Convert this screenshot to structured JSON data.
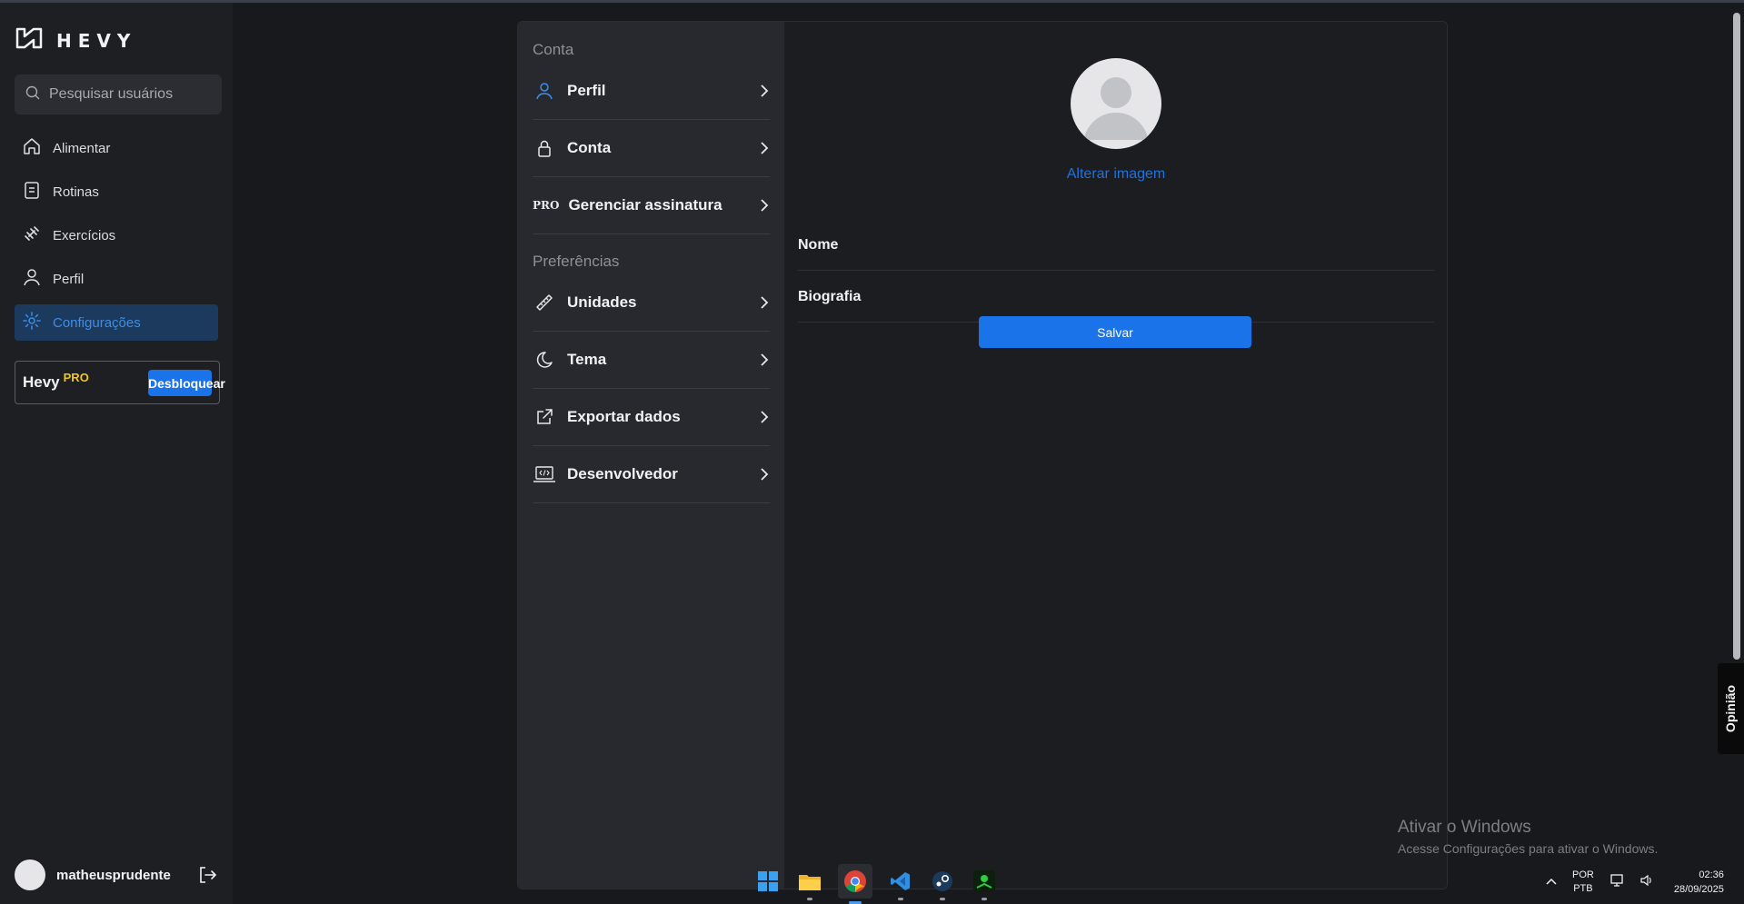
{
  "app": {
    "brand": "HEVY"
  },
  "sidebar": {
    "search_placeholder": "Pesquisar usuários",
    "items": [
      {
        "label": "Alimentar",
        "icon": "home-icon"
      },
      {
        "label": "Rotinas",
        "icon": "clipboard-icon"
      },
      {
        "label": "Exercícios",
        "icon": "dumbbell-icon"
      },
      {
        "label": "Perfil",
        "icon": "user-icon"
      },
      {
        "label": "Configurações",
        "icon": "gear-icon",
        "active": true
      }
    ],
    "pro_card": {
      "brand": "Hevy",
      "tag": "PRO",
      "button": "Desbloquear"
    },
    "user": {
      "name": "matheusprudente"
    }
  },
  "settings_menu": {
    "section_account": "Conta",
    "account_items": [
      {
        "label": "Perfil",
        "icon": "user-icon"
      },
      {
        "label": "Conta",
        "icon": "lock-icon"
      },
      {
        "label": "Gerenciar assinatura",
        "icon_text": "PRO"
      }
    ],
    "section_preferences": "Preferências",
    "preference_items": [
      {
        "label": "Unidades",
        "icon": "ruler-icon"
      },
      {
        "label": "Tema",
        "icon": "moon-icon"
      },
      {
        "label": "Exportar dados",
        "icon": "external-link-icon"
      },
      {
        "label": "Desenvolvedor",
        "icon": "laptop-code-icon"
      }
    ]
  },
  "profile_form": {
    "change_image": "Alterar imagem",
    "name_label": "Nome",
    "bio_label": "Biografia",
    "save_button": "Salvar"
  },
  "feedback_tab": "Opinião",
  "windows": {
    "watermark_title": "Ativar o Windows",
    "watermark_sub": "Acesse Configurações para ativar o Windows.",
    "lang_line1": "POR",
    "lang_line2": "PTB",
    "time": "02:36",
    "date": "28/09/2025"
  },
  "colors": {
    "accent": "#1a73e8",
    "active_bg": "#1c3a5e",
    "pro_gold": "#f5c518",
    "sidebar_bg": "#1e1f23",
    "menu_bg": "#27292e"
  }
}
